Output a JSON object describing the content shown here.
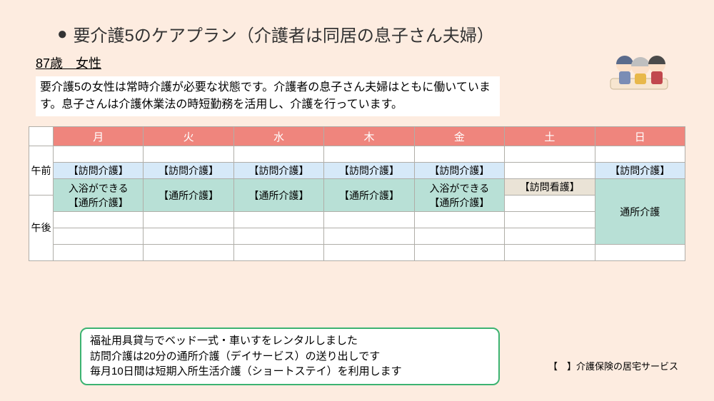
{
  "title": "要介護5のケアプラン（介護者は同居の息子さん夫婦）",
  "subject": "87歳　女性",
  "description": "要介護5の女性は常時介護が必要な状態です。介護者の息子さん夫婦はともに働いています。息子さんは介護休業法の時短勤務を活用し、介護を行っています。",
  "days": [
    "月",
    "火",
    "水",
    "木",
    "金",
    "土",
    "日"
  ],
  "time_labels": {
    "am": "午前",
    "pm": "午後"
  },
  "services": {
    "visit_care": "【訪問介護】",
    "visit_nurse": "【訪問看護】",
    "day_service": "【通所介護】",
    "day_service_plain": "通所介護",
    "bath_day": "入浴ができる\n【通所介護】"
  },
  "notes": [
    "福祉用具貸与でベッド一式・車いすをレンタルしました",
    "訪問介護は20分の通所介護（デイサービス）の送り出しです",
    "毎月10日間は短期入所生活介護（ショートステイ）を利用します"
  ],
  "legend": "【　】介護保険の居宅サービス"
}
